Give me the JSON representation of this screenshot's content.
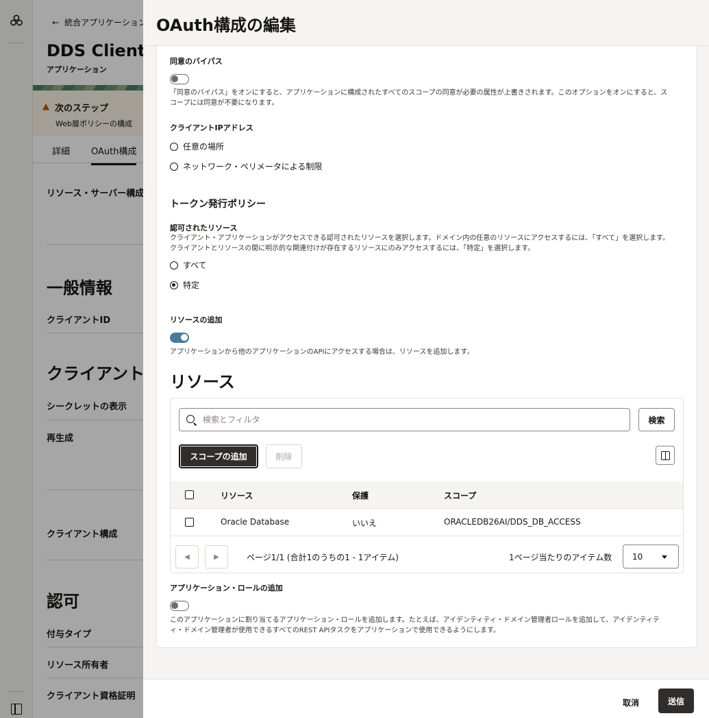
{
  "background": {
    "back_link": "統合アプリケーション",
    "app_title": "DDS Client",
    "app_subtitle": "アプリケーション",
    "next_step_title": "次のステップ",
    "next_step_sub": "Web層ポリシーの構成",
    "tabs": [
      "詳細",
      "OAuth構成"
    ],
    "resource_server": "リソース・サーバー構成",
    "general_heading": "一般情報",
    "client_id": "クライアントID",
    "client_heading": "クライアント",
    "show_secret": "シークレットの表示",
    "regenerate": "再生成",
    "client_config": "クライアント構成",
    "auth_heading": "認可",
    "grant_type": "付与タイプ",
    "resource_owner": "リソース所有者",
    "client_credentials": "クライアント資格証明"
  },
  "drawer": {
    "title": "OAuth構成の編集",
    "bypass_consent": {
      "label": "同意のバイパス",
      "help": "「同意のバイパス」をオンにすると、アプリケーションに構成されたすべてのスコープの同意が必要の属性が上書きされます。このオプションをオンにすると、スコープには同意が不要になります。",
      "on": false
    },
    "client_ip": {
      "label": "クライアントIPアドレス",
      "options": [
        "任意の場所",
        "ネットワーク・ペリメータによる制限"
      ]
    },
    "token_policy_heading": "トークン発行ポリシー",
    "authorized_resources": {
      "label": "認可されたリソース",
      "help": "クライアント・アプリケーションがアクセスできる認可されたリソースを選択します。ドメイン内の任意のリソースにアクセスするには、「すべて」を選択します。クライアントとリソースの間に明示的な関連付けが存在するリソースにのみアクセスするには、「特定」を選択します。",
      "options": [
        "すべて",
        "特定"
      ],
      "selected": "特定"
    },
    "add_resources": {
      "label": "リソースの追加",
      "help": "アプリケーションから他のアプリケーションのAPIにアクセスする場合は、リソースを追加します。",
      "on": true
    },
    "resources_heading": "リソース",
    "search": {
      "placeholder": "検索とフィルタ",
      "value": "",
      "button": "検索"
    },
    "add_scope_button": "スコープの追加",
    "delete_button": "削除",
    "table": {
      "columns": [
        "リソース",
        "保護",
        "スコープ"
      ],
      "rows": [
        {
          "resource": "Oracle Database",
          "protected": "いいえ",
          "scope": "ORACLEDB26AI/DDS_DB_ACCESS"
        }
      ]
    },
    "pager": {
      "status": "ページ1/1 (合計1のうちの1 - 1アイテム)",
      "per_page_label": "1ページ当たりのアイテム数",
      "per_page_value": "10"
    },
    "app_roles": {
      "label": "アプリケーション・ロールの追加",
      "help": "このアプリケーションに割り当てるアプリケーション・ロールを追加します。たとえば、アイデンティティ・ドメイン管理者ロールを追加して、アイデンティティ・ドメイン管理者が使用できるすべてのREST APIタスクをアプリケーションで使用できるようにします。",
      "on": false
    },
    "footer": {
      "cancel": "取消",
      "submit": "送信"
    }
  }
}
